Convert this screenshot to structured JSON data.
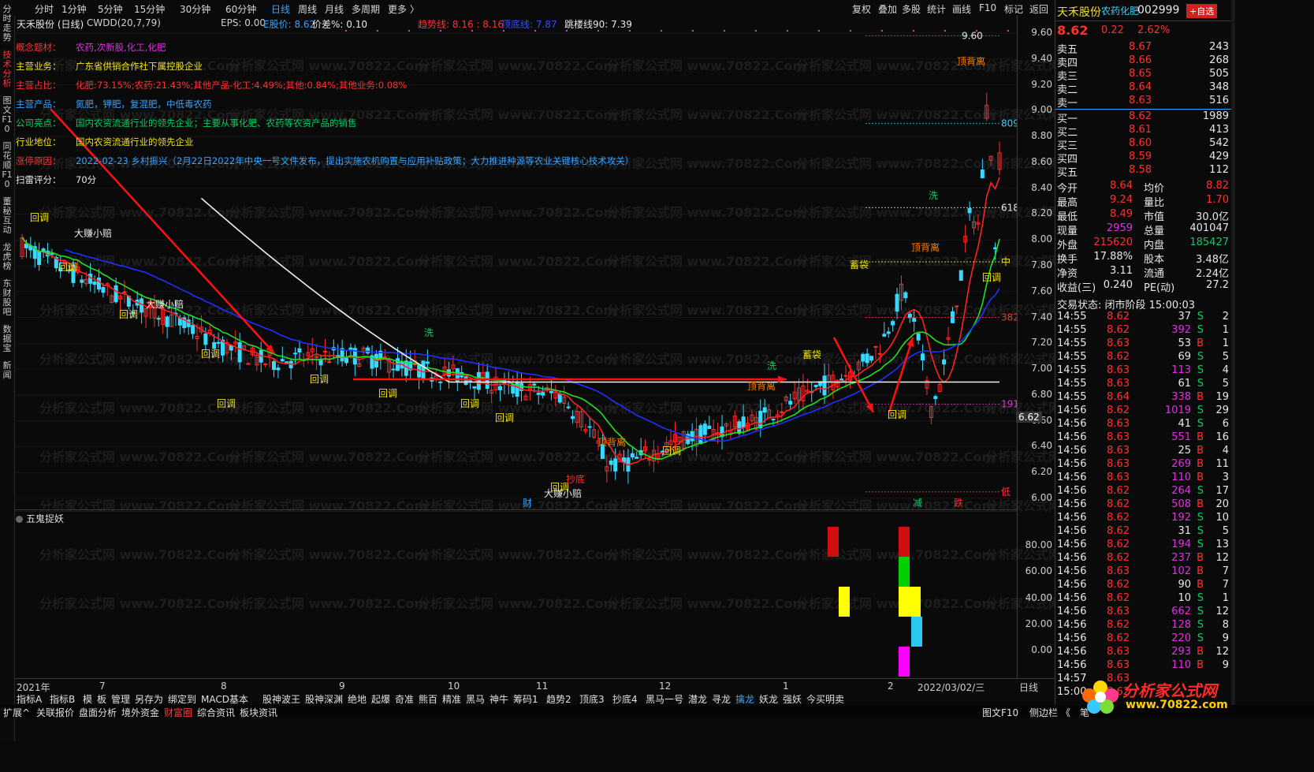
{
  "sidebar": [
    "分时走势",
    "技术分析",
    "图文F10",
    "同花顺F10",
    "董秘互动",
    "龙虎榜",
    "东财股吧",
    "数据宝",
    "新闻"
  ],
  "sidebar_active": 1,
  "topbar": {
    "periods": [
      "分时",
      "1分钟",
      "5分钟",
      "15分钟",
      "30分钟",
      "60分钟",
      "日线",
      "周线",
      "月线",
      "多周期",
      "更多 〉"
    ],
    "active_period": "日线",
    "right": [
      "复权",
      "叠加",
      "多股",
      "统计",
      "画线",
      "F10",
      "标记",
      "返回"
    ]
  },
  "title": {
    "name": "天禾股份 (日线)",
    "indicator": "CWDD(20,7,79)",
    "eps": "EPS: 0.00",
    "eprice": "E股价: 8.62",
    "diff": "价差%: 0.10",
    "trend": "趋势线: 8.16 : 8.16",
    "trend2": "顶底线: 7.87",
    "jump": "跳楼线90: 7.39"
  },
  "info": [
    {
      "k": "概念题材：",
      "v": "农药,次新股,化工,化肥",
      "color": "#e030e0"
    },
    {
      "k": "主营业务：",
      "v": "广东省供销合作社下属控股企业",
      "color": "#f0e020"
    },
    {
      "k": "主营占比：",
      "v": "化肥:73.15%;农药:21.43%;其他产品-化工:4.49%;其他:0.84%;其他业务:0.08%",
      "color": "#ff3030"
    },
    {
      "k": "主营产品：",
      "v": "氮肥，钾肥，复混肥，中低毒农药",
      "color": "#36a3ff"
    },
    {
      "k": "公司亮点：",
      "v": "国内农资流通行业的领先企业；主要从事化肥、农药等农资产品的销售",
      "color": "#00d060"
    },
    {
      "k": "行业地位：",
      "v": "国内农资流通行业的领先企业",
      "color": "#f0e020"
    },
    {
      "k": "涨停原因：",
      "v": "2022-02-23 乡村振兴（2月22日2022年中央一号文件发布，提出实施农机购置与应用补贴政策；大力推进种源等农业关键核心技术攻关）",
      "color": "#36a3ff"
    },
    {
      "k": "扫雷评分：",
      "v": "70分",
      "color": "#e8e8e8"
    }
  ],
  "chart_data": {
    "type": "candlestick",
    "y_ticks": [
      "9.60",
      "9.40",
      "9.20",
      "9.00",
      "8.80",
      "8.60",
      "8.40",
      "8.20",
      "8.00",
      "7.80",
      "7.60",
      "7.40",
      "7.20",
      "7.00",
      "6.80",
      "6.60",
      "6.40",
      "6.20",
      "6.00"
    ],
    "ylim": [
      6.0,
      9.6
    ],
    "current_price": "6.62",
    "levels": [
      {
        "label": "809",
        "value": 8.9,
        "color": "#36d0ff"
      },
      {
        "label": "618",
        "value": 8.25,
        "color": "#e8e8e8"
      },
      {
        "label": "中",
        "value": 7.83,
        "color": "#f0e020"
      },
      {
        "label": "382",
        "value": 7.4,
        "color": "#ff3030"
      },
      {
        "label": "191",
        "value": 6.73,
        "color": "#e030e0"
      },
      {
        "label": "低",
        "value": 6.05,
        "color": "#ff3030"
      }
    ],
    "high_label": "9.60",
    "annotations": [
      "回调",
      "大赚小赔",
      "顶背离",
      "洗",
      "蓄袋",
      "抄底",
      "减",
      "跌",
      "财"
    ],
    "date_labels": [
      "2021年",
      "7",
      "8",
      "9",
      "10",
      "11",
      "12",
      "1",
      "2",
      "2022/03/02/三"
    ]
  },
  "indicator": {
    "name": "五鬼捉妖",
    "y_ticks": [
      "80.00",
      "60.00",
      "40.00",
      "20.00",
      "0.00"
    ],
    "ylim": [
      0,
      100
    ]
  },
  "axis_tag": "日线",
  "tabs1": [
    "指标A",
    "指标B",
    "模",
    "板",
    "管理",
    "另存为",
    "绑定到",
    "MACD基本",
    "股神波王",
    "股神深渊",
    "绝地",
    "起爆",
    "奇准",
    "熊百",
    "精准",
    "黑马",
    "神牛",
    "筹码1",
    "趋势2",
    "顶底3",
    "抄底4",
    "黑马一号",
    "潜龙",
    "寻龙",
    "擒龙",
    "妖龙",
    "强妖",
    "今买明卖"
  ],
  "tabs1_active": "擒龙",
  "tabs2": [
    "扩展^",
    "关联报价",
    "盘面分析",
    "境外资金",
    "财富圈",
    "综合资讯",
    "板块资讯"
  ],
  "tabs2_active": "财富圈",
  "tabs2_right": [
    "图文F10",
    "侧边栏",
    "《",
    "笔"
  ],
  "panel": {
    "name": "天禾股份",
    "tag": "农药化肥",
    "code": "002999",
    "add_btn": "+自选",
    "price": "8.62",
    "change": "0.22",
    "pct": "2.62%",
    "sells": [
      {
        "l": "卖五",
        "p": "8.67",
        "v": "243"
      },
      {
        "l": "卖四",
        "p": "8.66",
        "v": "268"
      },
      {
        "l": "卖三",
        "p": "8.65",
        "v": "505"
      },
      {
        "l": "卖二",
        "p": "8.64",
        "v": "348"
      },
      {
        "l": "卖一",
        "p": "8.63",
        "v": "516"
      }
    ],
    "buys": [
      {
        "l": "买一",
        "p": "8.62",
        "v": "1989"
      },
      {
        "l": "买二",
        "p": "8.61",
        "v": "413"
      },
      {
        "l": "买三",
        "p": "8.60",
        "v": "542"
      },
      {
        "l": "买四",
        "p": "8.59",
        "v": "429"
      },
      {
        "l": "买五",
        "p": "8.58",
        "v": "112"
      }
    ],
    "stats": [
      {
        "a": "今开",
        "av": "8.64",
        "ac": "red",
        "b": "均价",
        "bv": "8.82",
        "bc": "red"
      },
      {
        "a": "最高",
        "av": "9.24",
        "ac": "red",
        "b": "量比",
        "bv": "1.70",
        "bc": "red"
      },
      {
        "a": "最低",
        "av": "8.49",
        "ac": "red",
        "b": "市值",
        "bv": "30.0亿",
        "bc": "white"
      },
      {
        "a": "现量",
        "av": "2959",
        "ac": "mag",
        "b": "总量",
        "bv": "401047",
        "bc": "white"
      },
      {
        "a": "外盘",
        "av": "215620",
        "ac": "red",
        "b": "内盘",
        "bv": "185427",
        "bc": "green"
      },
      {
        "a": "换手",
        "av": "17.88%",
        "ac": "white",
        "b": "股本",
        "bv": "3.48亿",
        "bc": "white"
      },
      {
        "a": "净资",
        "av": "3.11",
        "ac": "white",
        "b": "流通",
        "bv": "2.24亿",
        "bc": "white"
      },
      {
        "a": "收益(三)",
        "av": "0.240",
        "ac": "white",
        "b": "PE(动)",
        "bv": "27.2",
        "bc": "white"
      }
    ],
    "status": "交易状态: 闭市阶段 15:00:03",
    "ticks": [
      [
        "14:55",
        "8.62",
        "37",
        "S",
        "2"
      ],
      [
        "14:55",
        "8.62",
        "392",
        "S",
        "1"
      ],
      [
        "14:55",
        "8.63",
        "53",
        "B",
        "1"
      ],
      [
        "14:55",
        "8.62",
        "69",
        "S",
        "5"
      ],
      [
        "14:55",
        "8.63",
        "113",
        "S",
        "4"
      ],
      [
        "14:55",
        "8.63",
        "61",
        "S",
        "5"
      ],
      [
        "14:55",
        "8.64",
        "338",
        "B",
        "19"
      ],
      [
        "14:56",
        "8.62",
        "1019",
        "S",
        "29"
      ],
      [
        "14:56",
        "8.63",
        "41",
        "S",
        "6"
      ],
      [
        "14:56",
        "8.63",
        "551",
        "B",
        "16"
      ],
      [
        "14:56",
        "8.63",
        "25",
        "B",
        "4"
      ],
      [
        "14:56",
        "8.63",
        "269",
        "B",
        "11"
      ],
      [
        "14:56",
        "8.63",
        "110",
        "B",
        "3"
      ],
      [
        "14:56",
        "8.62",
        "264",
        "S",
        "17"
      ],
      [
        "14:56",
        "8.62",
        "508",
        "B",
        "20"
      ],
      [
        "14:56",
        "8.62",
        "192",
        "S",
        "10"
      ],
      [
        "14:56",
        "8.62",
        "31",
        "S",
        "5"
      ],
      [
        "14:56",
        "8.62",
        "194",
        "S",
        "13"
      ],
      [
        "14:56",
        "8.62",
        "237",
        "B",
        "12"
      ],
      [
        "14:56",
        "8.63",
        "102",
        "B",
        "7"
      ],
      [
        "14:56",
        "8.62",
        "90",
        "B",
        "7"
      ],
      [
        "14:56",
        "8.62",
        "10",
        "S",
        "1"
      ],
      [
        "14:56",
        "8.63",
        "662",
        "S",
        "12"
      ],
      [
        "14:56",
        "8.62",
        "128",
        "S",
        "8"
      ],
      [
        "14:56",
        "8.62",
        "220",
        "S",
        "9"
      ],
      [
        "14:56",
        "8.63",
        "293",
        "B",
        "12"
      ],
      [
        "14:56",
        "8.63",
        "110",
        "B",
        "9"
      ],
      [
        "14:57",
        "8.63",
        "",
        "",
        " "
      ],
      [
        "15:00",
        "8.62",
        "",
        "",
        " "
      ]
    ]
  },
  "logo": {
    "title": "分析家公式网",
    "url": "www.70822.com"
  },
  "watermark": "分析家公式网 www.70822.Com"
}
